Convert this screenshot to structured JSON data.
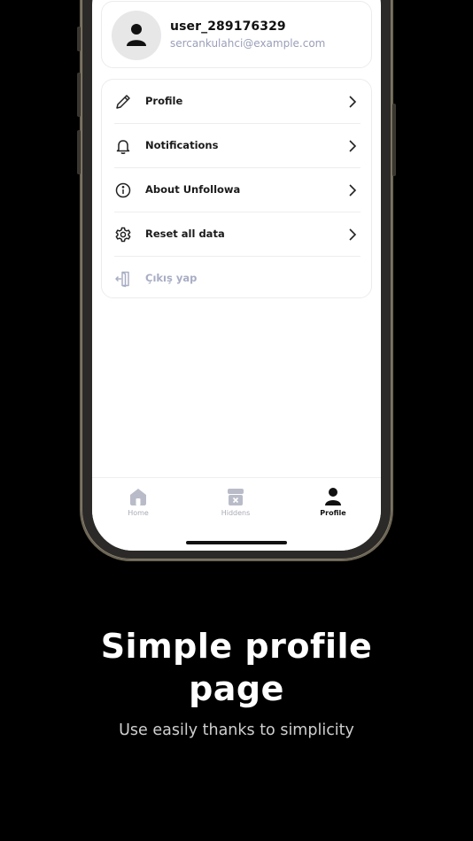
{
  "user": {
    "username": "user_289176329",
    "email": "sercankulahci@example.com"
  },
  "menu": {
    "items": [
      {
        "label": "Profile",
        "icon": "pencil-icon"
      },
      {
        "label": "Notifications",
        "icon": "bell-icon"
      },
      {
        "label": "About Unfollowa",
        "icon": "info-icon"
      },
      {
        "label": "Reset all data",
        "icon": "gear-icon"
      },
      {
        "label": "Çıkış yap",
        "icon": "logout-icon"
      }
    ]
  },
  "bottom_nav": {
    "tabs": [
      {
        "label": "Home",
        "icon": "home-icon",
        "active": false
      },
      {
        "label": "Hiddens",
        "icon": "archive-icon",
        "active": false
      },
      {
        "label": "Profile",
        "icon": "person-icon",
        "active": true
      }
    ]
  },
  "marketing": {
    "headline_line1": "Simple profile",
    "headline_line2": "page",
    "subline": "Use easily thanks to simplicity"
  },
  "colors": {
    "background": "#000000",
    "screen": "#ffffff",
    "muted_text": "#a8adc4",
    "inactive_nav": "#b9bcc8",
    "accent_text": "#111111"
  }
}
